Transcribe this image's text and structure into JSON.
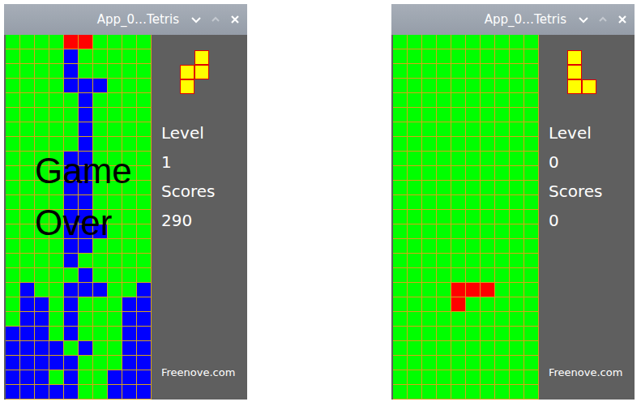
{
  "cell_colors": {
    "B": "#0000ff",
    "R": "#ff0000",
    "Y": "#ffff00"
  },
  "windows": [
    {
      "title": "App_0…Tetris",
      "game_over": true,
      "overlay": [
        "Game",
        "Over"
      ],
      "next_piece": [
        ".Y",
        "YY",
        "Y."
      ],
      "stats": [
        {
          "label": "Level",
          "value": "1"
        },
        {
          "label": "Scores",
          "value": "290"
        }
      ],
      "footer": "Freenove.com",
      "board": [
        "....RR....",
        "....B.....",
        "....B.....",
        "....BBB...",
        ".....B....",
        ".....B....",
        ".....B....",
        ".....B....",
        "....BB....",
        "....BB....",
        "....BB....",
        "....BB....",
        "....BB....",
        "....BBB...",
        "....BB....",
        "....B.....",
        ".....B....",
        ".B..BBB..B",
        ".BB.B...BB",
        ".BB.B...BB",
        "BBB.B...BB",
        "BBBB.B..BB",
        "BBBBB...BB",
        "BBB.B..BBB",
        "BBBBB..BBB"
      ]
    },
    {
      "title": "App_0…Tetris",
      "game_over": false,
      "overlay": [],
      "next_piece": [
        "Y.",
        "Y.",
        "YY"
      ],
      "stats": [
        {
          "label": "Level",
          "value": "0"
        },
        {
          "label": "Scores",
          "value": "0"
        }
      ],
      "footer": "Freenove.com",
      "board": [
        "..........",
        "..........",
        "..........",
        "..........",
        "..........",
        "..........",
        "..........",
        "..........",
        "..........",
        "..........",
        "..........",
        "..........",
        "..........",
        "..........",
        "..........",
        "..........",
        "..........",
        "....RRR...",
        "....R.....",
        "..........",
        "..........",
        "..........",
        "..........",
        "..........",
        ".........."
      ]
    }
  ]
}
